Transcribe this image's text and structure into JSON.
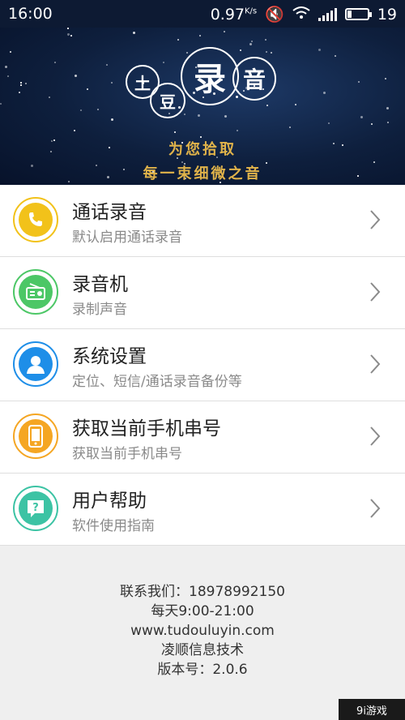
{
  "status": {
    "time": "16:00",
    "speed": "0.97",
    "speed_unit": "K/s",
    "battery": "19",
    "battery_level": 0.19
  },
  "banner": {
    "logo_chars": [
      "土",
      "豆",
      "录",
      "音"
    ],
    "slogan_line1": "为您拾取",
    "slogan_line2": "每一束细微之音"
  },
  "menu": [
    {
      "title": "通话录音",
      "subtitle": "默认启用通话录音",
      "icon": "phone-icon",
      "color": "#f2c21a"
    },
    {
      "title": "录音机",
      "subtitle": "录制声音",
      "icon": "radio-icon",
      "color": "#4cc766"
    },
    {
      "title": "系统设置",
      "subtitle": "定位、短信/通话录音备份等",
      "icon": "user-icon",
      "color": "#1e8ee8"
    },
    {
      "title": "获取当前手机串号",
      "subtitle": "获取当前手机串号",
      "icon": "mobile-icon",
      "color": "#f5a623"
    },
    {
      "title": "用户帮助",
      "subtitle": "软件使用指南",
      "icon": "help-icon",
      "color": "#3cc3a4"
    }
  ],
  "footer": {
    "contact": "联系我们：18978992150",
    "hours": "每天9:00-21:00",
    "website": "www.tudouluyin.com",
    "company": "凌顺信息技术",
    "version": "版本号：2.0.6"
  },
  "watermark": "9i游戏"
}
